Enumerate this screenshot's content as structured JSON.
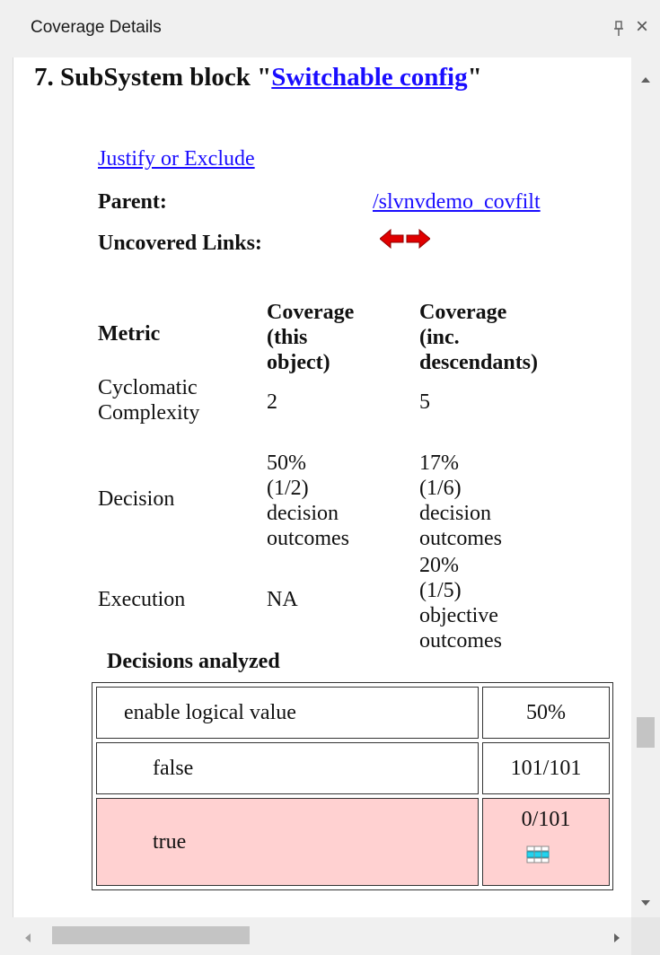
{
  "pane": {
    "title": "Coverage Details"
  },
  "section": {
    "prefix": "7. SubSystem block \"",
    "block_link": "Switchable config",
    "suffix": "\""
  },
  "justify_link": "Justify or Exclude",
  "parent": {
    "label": "Parent:",
    "link": "/slvnvdemo_covfilt"
  },
  "uncovered_links": {
    "label": "Uncovered Links:"
  },
  "metrics_table": {
    "headers": {
      "metric": "Metric",
      "this_object": [
        "Coverage",
        "(this object)"
      ],
      "descendants": [
        "Coverage (inc.",
        "descendants)"
      ]
    },
    "rows": [
      {
        "metric": [
          "Cyclomatic",
          "Complexity"
        ],
        "this_object": [
          "2"
        ],
        "descendants": [
          "5"
        ]
      },
      {
        "metric": [
          "Decision"
        ],
        "this_object": [
          "50% (1/2)",
          "decision",
          "outcomes"
        ],
        "descendants": [
          "17% (1/6)",
          "decision",
          "outcomes"
        ]
      },
      {
        "metric": [
          "Execution"
        ],
        "this_object": [
          "NA"
        ],
        "descendants": [
          "20% (1/5)",
          "objective",
          "outcomes"
        ]
      }
    ]
  },
  "decisions": {
    "title": "Decisions analyzed",
    "rows": [
      {
        "label": "enable logical value",
        "value": "50%",
        "covered": true
      },
      {
        "label": "false",
        "value": "101/101",
        "covered": true
      },
      {
        "label": "true",
        "value": "0/101",
        "covered": false
      }
    ]
  },
  "colors": {
    "link": "#1a0dff",
    "uncovered_bg": "#ffd1d1",
    "arrow": "#e00000"
  },
  "icons": [
    "pin-icon",
    "close-icon",
    "left-arrow-icon",
    "right-arrow-icon",
    "coverage-data-icon",
    "scroll-up-icon",
    "scroll-down-icon",
    "scroll-left-icon",
    "scroll-right-icon"
  ]
}
